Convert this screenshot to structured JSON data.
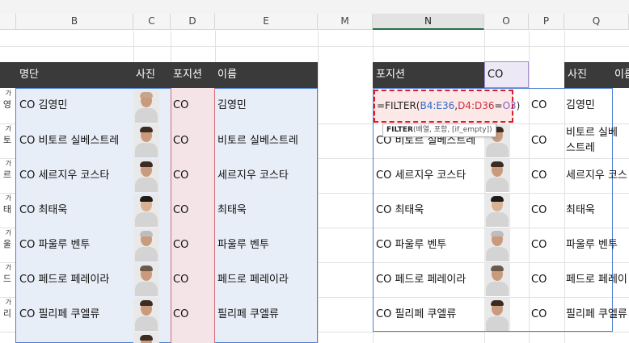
{
  "columns": [
    "B",
    "C",
    "D",
    "E",
    "M",
    "N",
    "O",
    "P",
    "Q"
  ],
  "selected_column": "N",
  "left_table": {
    "headers": {
      "b": "명단",
      "c": "사진",
      "d": "포지션",
      "e": "이름"
    },
    "rows": [
      {
        "b": "CO 김영민",
        "d": "CO",
        "e": "김영민",
        "frag": "영"
      },
      {
        "b": "CO 비토르 실베스트레",
        "d": "CO",
        "e": "비토르 실베스트레",
        "frag": "토"
      },
      {
        "b": "CO 세르지우 코스타",
        "d": "CO",
        "e": "세르지우 코스타",
        "frag": "르"
      },
      {
        "b": "CO 최태욱",
        "d": "CO",
        "e": "최태욱",
        "frag": "태"
      },
      {
        "b": "CO 파울루 벤투",
        "d": "CO",
        "e": "파울루 벤투",
        "frag": "울"
      },
      {
        "b": "CO 페드로 페레이라",
        "d": "CO",
        "e": "페드로 페레이라",
        "frag": "드"
      },
      {
        "b": "CO 필리페 쿠엘류",
        "d": "CO",
        "e": "필리페 쿠엘류",
        "frag": "리"
      }
    ]
  },
  "right_table": {
    "headers": {
      "n": "포지션",
      "o": "CO",
      "q": "사진",
      "r": "이름"
    },
    "formula": {
      "prefix": "=FILTER(",
      "range1": "B4:E36",
      "sep": ",",
      "range2": "D4:D36",
      "eq": "=",
      "ref": "O3",
      "suffix": ")"
    },
    "tooltip": {
      "fn": "FILTER",
      "args": "(배열, 포함, [if_empty])"
    },
    "rows": [
      {
        "n": "",
        "p": "CO",
        "q": "김영민"
      },
      {
        "n": "CO 비토르 실베스트레",
        "p": "CO",
        "q": "비토르 실베스트레"
      },
      {
        "n": "CO 세르지우 코스타",
        "p": "CO",
        "q": "세르지우 코스"
      },
      {
        "n": "CO 최태욱",
        "p": "CO",
        "q": "최태욱"
      },
      {
        "n": "CO 파울루 벤투",
        "p": "CO",
        "q": "파울루 벤투"
      },
      {
        "n": "CO 페드로 페레이라",
        "p": "CO",
        "q": "페드로 페레이"
      },
      {
        "n": "CO 필리페 쿠엘류",
        "p": "CO",
        "q": "필리페 쿠엘류"
      }
    ]
  },
  "colors": {
    "header_band": "#3a3a3a",
    "source_range": "#4a7fd4",
    "criteria_range": "#d86a78",
    "formula_outline": "#d61f2c"
  }
}
